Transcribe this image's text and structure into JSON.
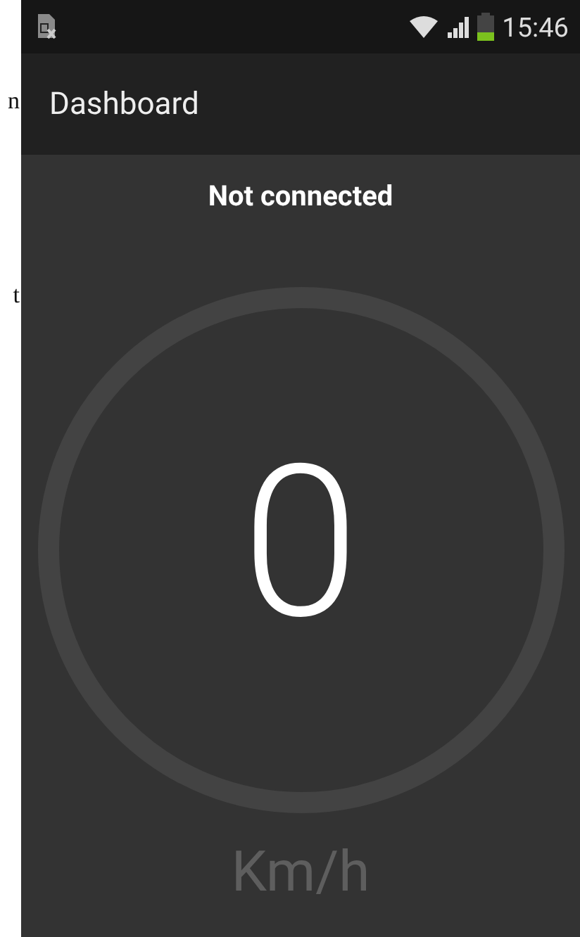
{
  "margin_fragments": [
    "n",
    "t"
  ],
  "status_bar": {
    "time": "15:46"
  },
  "app_bar": {
    "title": "Dashboard"
  },
  "connection_status": "Not connected",
  "speedometer": {
    "speed": "0",
    "unit": "Km/h"
  }
}
